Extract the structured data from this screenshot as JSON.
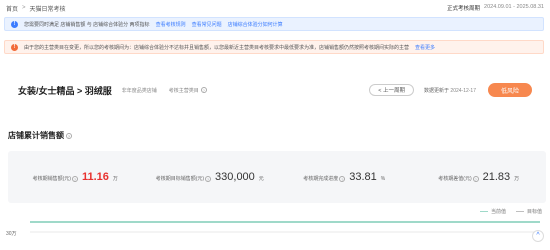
{
  "breadcrumb": {
    "home": "首页",
    "current": "天猫日常考核"
  },
  "period": {
    "label": "正式考核周期",
    "value": "2024.09.01 - 2025.08.31"
  },
  "info_bar": {
    "text": "您需要同时满足 店铺销售额 与 店铺综合体验分 两项指标",
    "links": [
      "查看考核规则",
      "查看常见问题",
      "店铺综合体验分如何计算"
    ]
  },
  "warn_bar": {
    "text": "由于您的主营类目在变更，所以您的考核期间为：店铺综合体验分不达标并且销售额，以您最新近主营类目考核要求中最低要求为准，店铺销售额仍然按照考核期间实际的主营",
    "link": "查看更多"
  },
  "category": {
    "title": "女装/女士精品 > 羽绒服",
    "tag": "非年度品类店铺",
    "tag2": "考核主营类目",
    "prev_button": "< 上一周期",
    "updated_label": "数据更新于",
    "updated_value": "2024-12-17",
    "risk_button": "低风险"
  },
  "section_title": "店铺累计销售额",
  "metrics": [
    {
      "label": "考核期销售额(元)",
      "value": "11.16",
      "unit": "万",
      "highlight": true
    },
    {
      "label": "考核期目标销售额(元)",
      "value": "330,000",
      "unit": "元",
      "highlight": false
    },
    {
      "label": "考核期完成进度",
      "value": "33.81",
      "unit": "%",
      "highlight": false
    },
    {
      "label": "考核期差值(元)",
      "value": "21.83",
      "unit": "万",
      "highlight": false
    }
  ],
  "chart_data": {
    "type": "line",
    "series": [
      {
        "name": "当前值",
        "color": "#9fd9c9"
      },
      {
        "name": "目标值",
        "color": "#bfbfbf"
      }
    ],
    "yticks": [
      "30万"
    ]
  },
  "icons": {
    "info": "info-icon",
    "warn": "warning-icon",
    "help": "question-circle-icon",
    "expand": "chevron-up-icon"
  }
}
